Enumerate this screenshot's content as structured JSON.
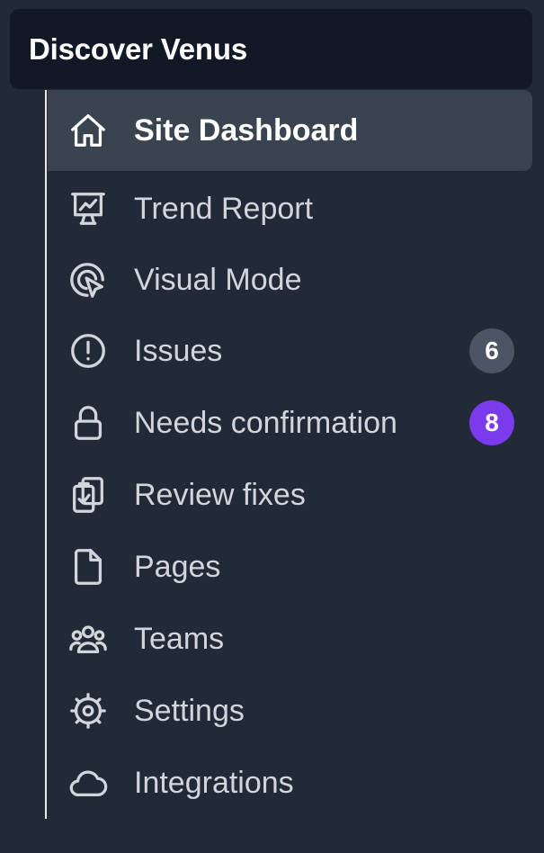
{
  "site": {
    "title": "Discover Venus"
  },
  "nav": {
    "items": [
      {
        "label": "Site Dashboard",
        "icon": "home-icon",
        "active": true
      },
      {
        "label": "Trend Report",
        "icon": "presentation-chart-icon"
      },
      {
        "label": "Visual Mode",
        "icon": "cursor-rays-icon"
      },
      {
        "label": "Issues",
        "icon": "exclamation-circle-icon",
        "badge": "6",
        "badge_color": "#4b5563"
      },
      {
        "label": "Needs confirmation",
        "icon": "lock-icon",
        "badge": "8",
        "badge_color": "#7c3aed"
      },
      {
        "label": "Review fixes",
        "icon": "clipboard-check-icon"
      },
      {
        "label": "Pages",
        "icon": "document-icon"
      },
      {
        "label": "Teams",
        "icon": "user-group-icon"
      },
      {
        "label": "Settings",
        "icon": "cog-icon"
      },
      {
        "label": "Integrations",
        "icon": "cloud-icon"
      }
    ]
  },
  "colors": {
    "sidebar_bg": "#222a38",
    "header_bg": "#121826",
    "active_bg": "#3a4350",
    "text": "#d2d5dc",
    "text_active": "#ffffff"
  }
}
